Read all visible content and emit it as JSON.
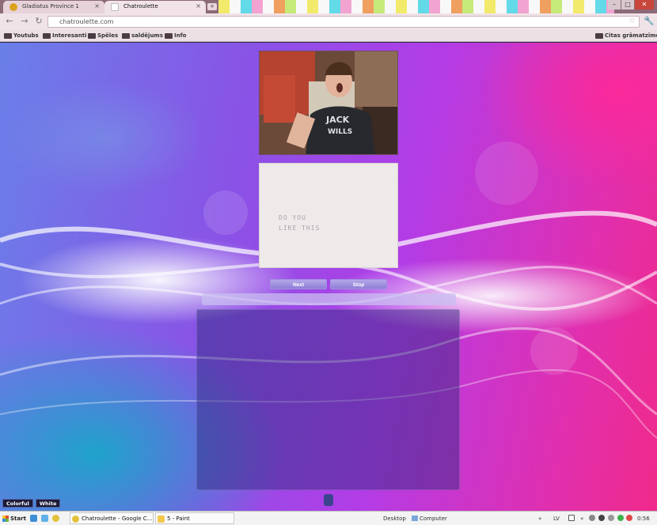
{
  "browser": {
    "tabs": [
      {
        "title": "Gladiatus Province 1"
      },
      {
        "title": "Chatroulette"
      }
    ],
    "close_glyph": "×",
    "new_tab_glyph": "+",
    "window_buttons": {
      "minimize": "–",
      "maximize": "□",
      "close": "✕"
    },
    "url": "chatroulette.com",
    "bookmarks": [
      {
        "label": "Youtubs"
      },
      {
        "label": "Interesanti"
      },
      {
        "label": "Spēles"
      },
      {
        "label": "saldējums"
      },
      {
        "label": "Info"
      }
    ],
    "other_bookmarks": "Citas grāmatzīmes",
    "icons": {
      "back": "back-icon",
      "forward": "forward-icon",
      "star": "star-icon",
      "wrench": "wrench-icon"
    }
  },
  "page": {
    "partner_video_caption": "JACK WILLS",
    "own_video_text_line1": "DO YOU",
    "own_video_text_line2": "LIKE THIS",
    "controls": {
      "next": "Next",
      "stop": "Stop"
    },
    "themes": [
      "Colorful",
      "White"
    ]
  },
  "taskbar": {
    "start": "Start",
    "tasks": [
      {
        "label": "Chatroulette - Google C..."
      },
      {
        "label": "5 - Paint"
      }
    ],
    "desktop": "Desktop",
    "computer": "Computer",
    "language": "LV",
    "clock": "0:56"
  },
  "colors": {
    "accent": "#8e7ed6",
    "tab_bar": "#8c6a78",
    "close_red": "#c9463d"
  }
}
